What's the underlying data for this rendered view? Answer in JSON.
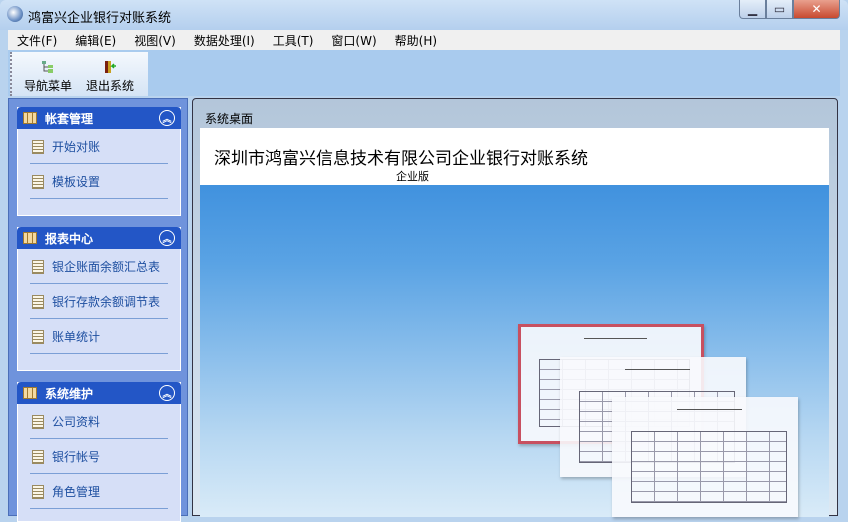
{
  "window": {
    "title": "鸿富兴企业银行对账系统"
  },
  "menu": [
    "文件(F)",
    "编辑(E)",
    "视图(V)",
    "数据处理(I)",
    "工具(T)",
    "窗口(W)",
    "帮助(H)"
  ],
  "toolbar": {
    "nav_menu": "导航菜单",
    "exit": "退出系统"
  },
  "sidebar": {
    "panels": [
      {
        "title": "帐套管理",
        "items": [
          "开始对账",
          "模板设置"
        ]
      },
      {
        "title": "报表中心",
        "items": [
          "银企账面余额汇总表",
          "银行存款余额调节表",
          "账单统计"
        ]
      },
      {
        "title": "系统维护",
        "items": [
          "公司资料",
          "银行帐号",
          "角色管理"
        ]
      }
    ]
  },
  "main": {
    "tab": "系统桌面",
    "heading": "深圳市鸿富兴信息技术有限公司企业银行对账系统",
    "edition": "企业版"
  }
}
